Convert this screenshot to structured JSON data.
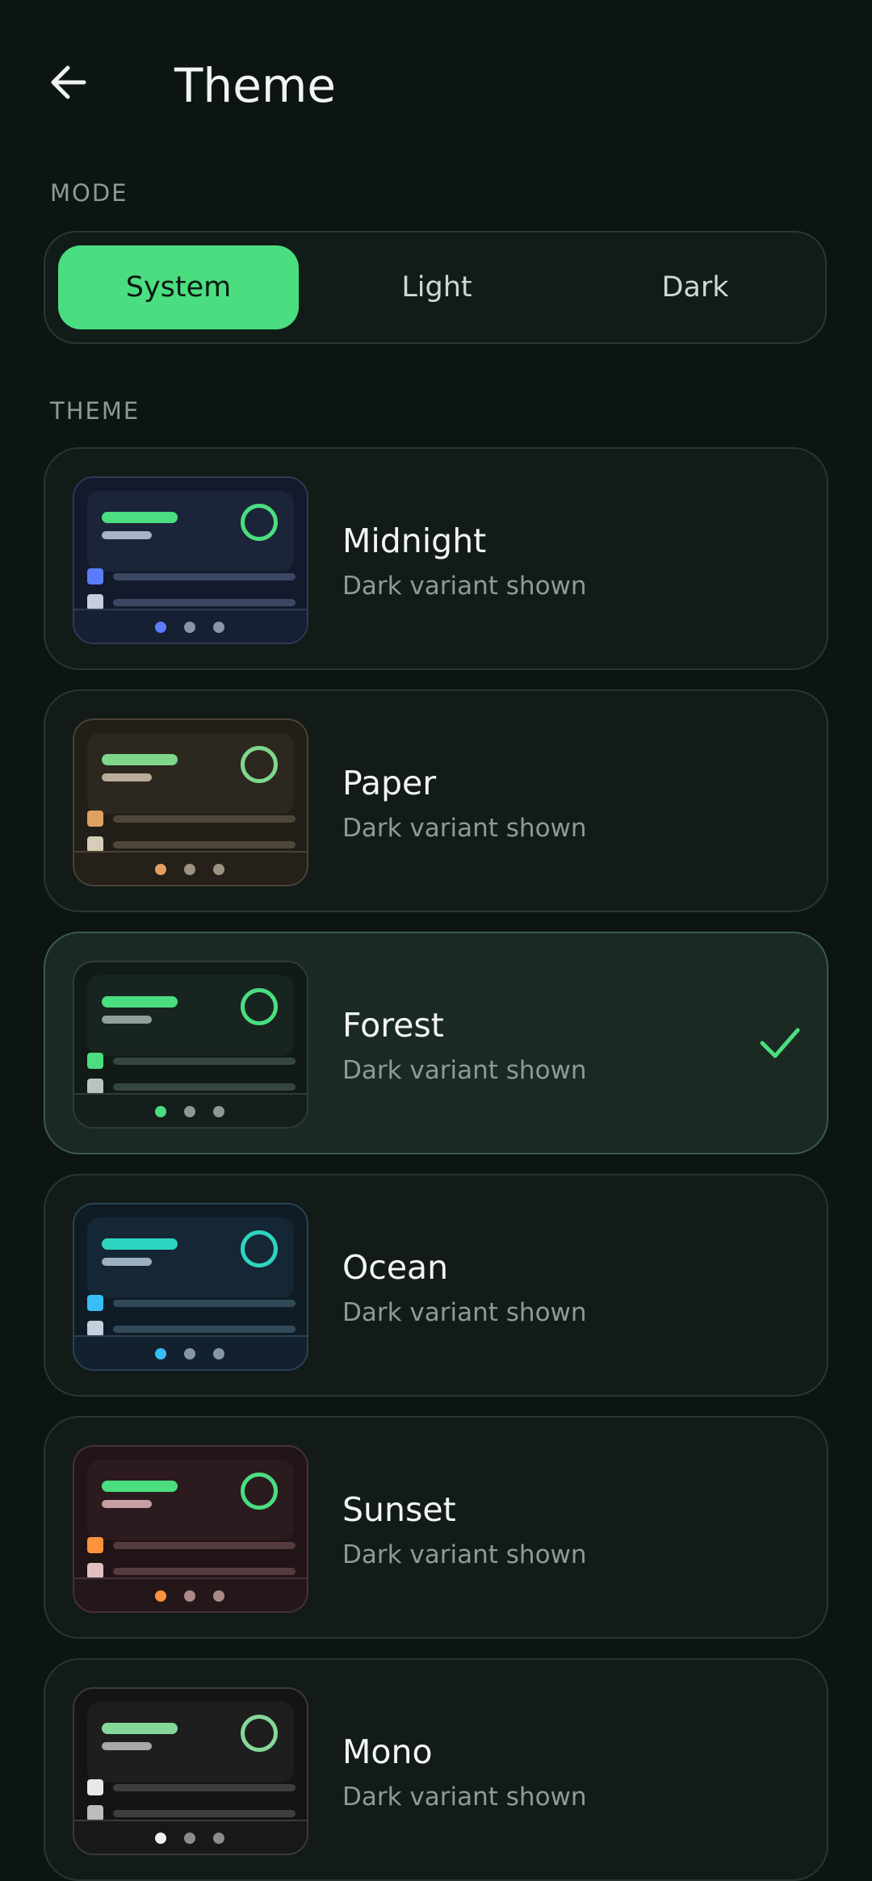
{
  "header": {
    "title": "Theme"
  },
  "mode": {
    "section_label": "MODE",
    "options": [
      "System",
      "Light",
      "Dark"
    ],
    "selected": "System"
  },
  "themes": {
    "section_label": "THEME",
    "subtitle": "Dark variant shown",
    "items": [
      {
        "name": "Midnight",
        "selected": false
      },
      {
        "name": "Paper",
        "selected": false
      },
      {
        "name": "Forest",
        "selected": true
      },
      {
        "name": "Ocean",
        "selected": false
      },
      {
        "name": "Sunset",
        "selected": false
      },
      {
        "name": "Mono",
        "selected": false
      }
    ]
  },
  "colors": {
    "accent": "#4ade80",
    "background": "#0c1514"
  },
  "icons": {
    "back": "arrow-left-icon",
    "check": "check-icon"
  }
}
